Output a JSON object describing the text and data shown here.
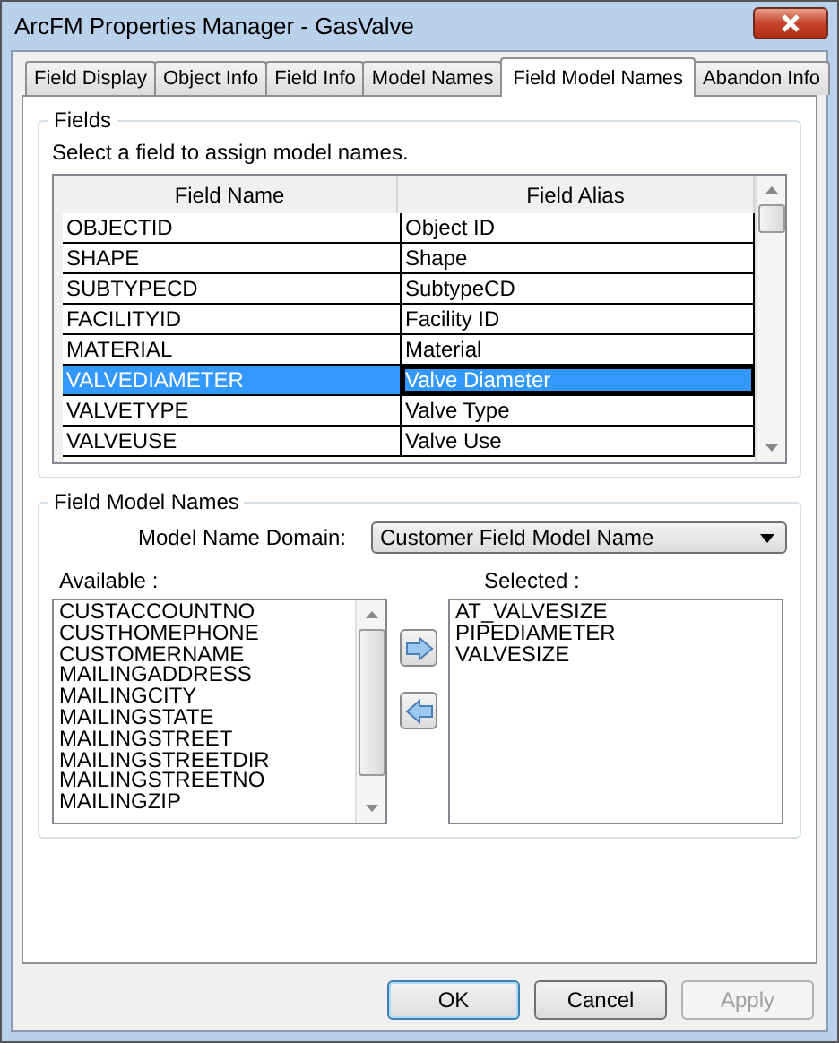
{
  "window": {
    "title": "ArcFM Properties Manager - GasValve"
  },
  "tabs": [
    {
      "label": "Field Display",
      "selected": false
    },
    {
      "label": "Object Info",
      "selected": false
    },
    {
      "label": "Field Info",
      "selected": false
    },
    {
      "label": "Model Names",
      "selected": false
    },
    {
      "label": "Field Model Names",
      "selected": true
    },
    {
      "label": "Abandon Info",
      "selected": false
    }
  ],
  "fields": {
    "title": "Fields",
    "instruction": "Select a field to assign model names.",
    "columns": [
      "Field Name",
      "Field Alias"
    ],
    "rows": [
      {
        "name": "OBJECTID",
        "alias": "Object ID",
        "selected": false
      },
      {
        "name": "SHAPE",
        "alias": "Shape",
        "selected": false
      },
      {
        "name": "SUBTYPECD",
        "alias": "SubtypeCD",
        "selected": false
      },
      {
        "name": "FACILITYID",
        "alias": "Facility ID",
        "selected": false
      },
      {
        "name": "MATERIAL",
        "alias": "Material",
        "selected": false
      },
      {
        "name": "VALVEDIAMETER",
        "alias": "Valve Diameter",
        "selected": true
      },
      {
        "name": "VALVETYPE",
        "alias": "Valve Type",
        "selected": false
      },
      {
        "name": "VALVEUSE",
        "alias": "Valve Use",
        "selected": false
      }
    ]
  },
  "field_model_names": {
    "title": "Field Model Names",
    "domain_label": "Model Name Domain:",
    "domain_value": "Customer Field Model Name",
    "available_label": "Available :",
    "selected_label": "Selected :",
    "available": [
      "CUSTACCOUNTNO",
      "CUSTHOMEPHONE",
      "CUSTOMERNAME",
      "MAILINGADDRESS",
      "MAILINGCITY",
      "MAILINGSTATE",
      "MAILINGSTREET",
      "MAILINGSTREETDIR",
      "MAILINGSTREETNO",
      "MAILINGZIP"
    ],
    "selected": [
      "AT_VALVESIZE",
      "PIPEDIAMETER",
      "VALVESIZE"
    ]
  },
  "buttons": [
    {
      "label": "OK",
      "kind": "default",
      "disabled": false
    },
    {
      "label": "Cancel",
      "kind": "normal",
      "disabled": false
    },
    {
      "label": "Apply",
      "kind": "normal",
      "disabled": true
    }
  ]
}
